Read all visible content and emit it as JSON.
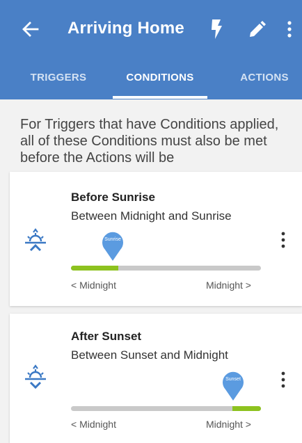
{
  "appbar": {
    "title": "Arriving Home",
    "back_icon": "arrow-left-icon",
    "bolt_icon": "lightning-bolt-icon",
    "edit_icon": "pencil-icon",
    "more_icon": "more-vert-icon"
  },
  "tabs": [
    {
      "label": "TRIGGERS",
      "active": false
    },
    {
      "label": "CONDITIONS",
      "active": true
    },
    {
      "label": "ACTIONS",
      "active": false
    }
  ],
  "info_text": "For Triggers that have Conditions applied, all of these Conditions must also be met before the Actions will be",
  "conditions": [
    {
      "title": "Before Sunrise",
      "subtitle": "Between Midnight and Sunrise",
      "icon": "sunrise-icon",
      "marker_label": "Sunrise",
      "range_start": "< Midnight",
      "range_end": "Midnight >",
      "fill_from": 0.0,
      "fill_to": 0.25
    },
    {
      "title": "After Sunset",
      "subtitle": "Between Sunset and Midnight",
      "icon": "sunset-icon",
      "marker_label": "Sunset",
      "range_start": "< Midnight",
      "range_end": "Midnight >",
      "fill_from": 0.85,
      "fill_to": 1.0
    }
  ],
  "colors": {
    "appbar": "#4a80c6",
    "accent_green": "#8dc21f",
    "marker_blue": "#5b9be0",
    "icon_blue": "#3a78c4"
  }
}
